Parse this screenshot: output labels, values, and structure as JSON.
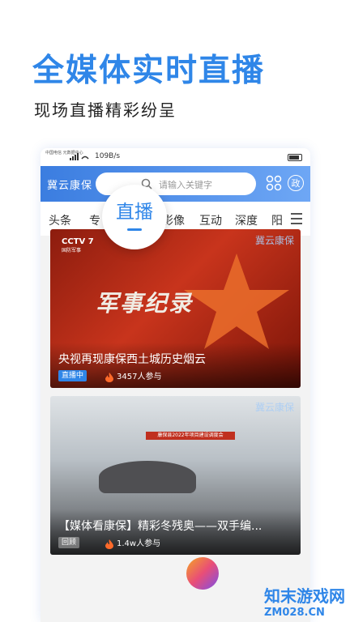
{
  "promo": {
    "title": "全媒体实时直播",
    "subtitle": "现场直播精彩纷呈"
  },
  "status": {
    "carrier": "中国电信\n元数据中心",
    "speed": "109B/s"
  },
  "topbar": {
    "brand": "冀云康保",
    "search_placeholder": "请输入关键字",
    "gov_label": "政"
  },
  "tabs": [
    "头条",
    "专",
    "影像",
    "互动",
    "深度",
    "阳"
  ],
  "live_bubble": {
    "label": "直播"
  },
  "cards": [
    {
      "logo_main": "CCTV 7",
      "logo_sub": "国防军事",
      "brand": "冀云康保",
      "art_text": "军事纪录",
      "title": "央视再现康保西土城历史烟云",
      "tag": "直播中",
      "viewers": "3457人参与"
    },
    {
      "brand": "冀云康保",
      "banner": "康保县2022年项目建设调度会",
      "title": "【媒体看康保】精彩冬残奥——双手编...",
      "tag": "回顾",
      "viewers": "1.4w人参与"
    }
  ],
  "watermark": {
    "name": "知末游戏网",
    "url": "ZM028.CN"
  },
  "colors": {
    "accent": "#2f86e8",
    "topbar": "#3b7de0",
    "live_tag": "#2f86e8"
  }
}
